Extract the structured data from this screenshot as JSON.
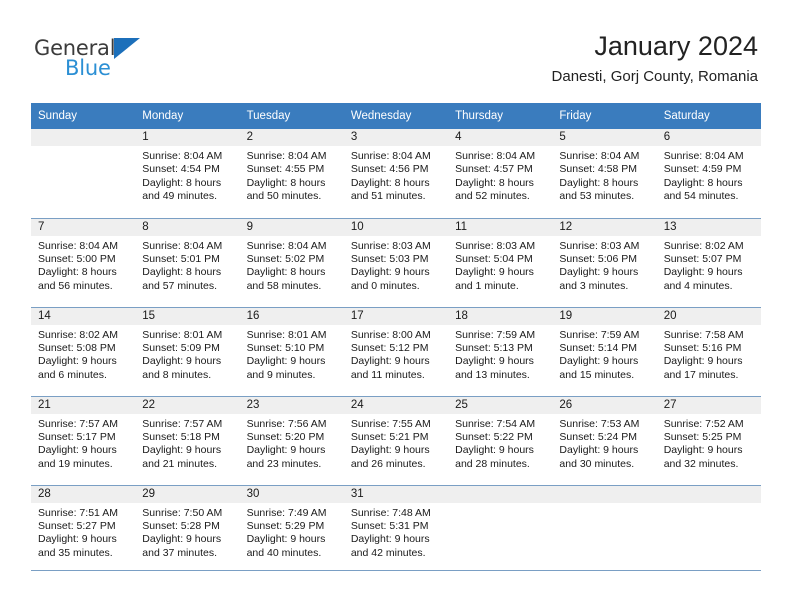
{
  "brand": {
    "name_part1": "General",
    "name_part2": "Blue",
    "triangle_icon": "triangle-icon",
    "color_primary": "#1c6fba",
    "color_secondary": "#2b8fd4"
  },
  "header": {
    "title": "January 2024",
    "subtitle": "Danesti, Gorj County, Romania"
  },
  "calendar": {
    "header_bg": "#3a7cbe",
    "daynum_bg": "#efefef",
    "weekdays": [
      "Sunday",
      "Monday",
      "Tuesday",
      "Wednesday",
      "Thursday",
      "Friday",
      "Saturday"
    ],
    "weeks": [
      [
        {
          "day": "",
          "sunrise": "",
          "sunset": "",
          "daylight": "",
          "empty": true
        },
        {
          "day": "1",
          "sunrise": "Sunrise: 8:04 AM",
          "sunset": "Sunset: 4:54 PM",
          "daylight": "Daylight: 8 hours and 49 minutes."
        },
        {
          "day": "2",
          "sunrise": "Sunrise: 8:04 AM",
          "sunset": "Sunset: 4:55 PM",
          "daylight": "Daylight: 8 hours and 50 minutes."
        },
        {
          "day": "3",
          "sunrise": "Sunrise: 8:04 AM",
          "sunset": "Sunset: 4:56 PM",
          "daylight": "Daylight: 8 hours and 51 minutes."
        },
        {
          "day": "4",
          "sunrise": "Sunrise: 8:04 AM",
          "sunset": "Sunset: 4:57 PM",
          "daylight": "Daylight: 8 hours and 52 minutes."
        },
        {
          "day": "5",
          "sunrise": "Sunrise: 8:04 AM",
          "sunset": "Sunset: 4:58 PM",
          "daylight": "Daylight: 8 hours and 53 minutes."
        },
        {
          "day": "6",
          "sunrise": "Sunrise: 8:04 AM",
          "sunset": "Sunset: 4:59 PM",
          "daylight": "Daylight: 8 hours and 54 minutes."
        }
      ],
      [
        {
          "day": "7",
          "sunrise": "Sunrise: 8:04 AM",
          "sunset": "Sunset: 5:00 PM",
          "daylight": "Daylight: 8 hours and 56 minutes."
        },
        {
          "day": "8",
          "sunrise": "Sunrise: 8:04 AM",
          "sunset": "Sunset: 5:01 PM",
          "daylight": "Daylight: 8 hours and 57 minutes."
        },
        {
          "day": "9",
          "sunrise": "Sunrise: 8:04 AM",
          "sunset": "Sunset: 5:02 PM",
          "daylight": "Daylight: 8 hours and 58 minutes."
        },
        {
          "day": "10",
          "sunrise": "Sunrise: 8:03 AM",
          "sunset": "Sunset: 5:03 PM",
          "daylight": "Daylight: 9 hours and 0 minutes."
        },
        {
          "day": "11",
          "sunrise": "Sunrise: 8:03 AM",
          "sunset": "Sunset: 5:04 PM",
          "daylight": "Daylight: 9 hours and 1 minute."
        },
        {
          "day": "12",
          "sunrise": "Sunrise: 8:03 AM",
          "sunset": "Sunset: 5:06 PM",
          "daylight": "Daylight: 9 hours and 3 minutes."
        },
        {
          "day": "13",
          "sunrise": "Sunrise: 8:02 AM",
          "sunset": "Sunset: 5:07 PM",
          "daylight": "Daylight: 9 hours and 4 minutes."
        }
      ],
      [
        {
          "day": "14",
          "sunrise": "Sunrise: 8:02 AM",
          "sunset": "Sunset: 5:08 PM",
          "daylight": "Daylight: 9 hours and 6 minutes."
        },
        {
          "day": "15",
          "sunrise": "Sunrise: 8:01 AM",
          "sunset": "Sunset: 5:09 PM",
          "daylight": "Daylight: 9 hours and 8 minutes."
        },
        {
          "day": "16",
          "sunrise": "Sunrise: 8:01 AM",
          "sunset": "Sunset: 5:10 PM",
          "daylight": "Daylight: 9 hours and 9 minutes."
        },
        {
          "day": "17",
          "sunrise": "Sunrise: 8:00 AM",
          "sunset": "Sunset: 5:12 PM",
          "daylight": "Daylight: 9 hours and 11 minutes."
        },
        {
          "day": "18",
          "sunrise": "Sunrise: 7:59 AM",
          "sunset": "Sunset: 5:13 PM",
          "daylight": "Daylight: 9 hours and 13 minutes."
        },
        {
          "day": "19",
          "sunrise": "Sunrise: 7:59 AM",
          "sunset": "Sunset: 5:14 PM",
          "daylight": "Daylight: 9 hours and 15 minutes."
        },
        {
          "day": "20",
          "sunrise": "Sunrise: 7:58 AM",
          "sunset": "Sunset: 5:16 PM",
          "daylight": "Daylight: 9 hours and 17 minutes."
        }
      ],
      [
        {
          "day": "21",
          "sunrise": "Sunrise: 7:57 AM",
          "sunset": "Sunset: 5:17 PM",
          "daylight": "Daylight: 9 hours and 19 minutes."
        },
        {
          "day": "22",
          "sunrise": "Sunrise: 7:57 AM",
          "sunset": "Sunset: 5:18 PM",
          "daylight": "Daylight: 9 hours and 21 minutes."
        },
        {
          "day": "23",
          "sunrise": "Sunrise: 7:56 AM",
          "sunset": "Sunset: 5:20 PM",
          "daylight": "Daylight: 9 hours and 23 minutes."
        },
        {
          "day": "24",
          "sunrise": "Sunrise: 7:55 AM",
          "sunset": "Sunset: 5:21 PM",
          "daylight": "Daylight: 9 hours and 26 minutes."
        },
        {
          "day": "25",
          "sunrise": "Sunrise: 7:54 AM",
          "sunset": "Sunset: 5:22 PM",
          "daylight": "Daylight: 9 hours and 28 minutes."
        },
        {
          "day": "26",
          "sunrise": "Sunrise: 7:53 AM",
          "sunset": "Sunset: 5:24 PM",
          "daylight": "Daylight: 9 hours and 30 minutes."
        },
        {
          "day": "27",
          "sunrise": "Sunrise: 7:52 AM",
          "sunset": "Sunset: 5:25 PM",
          "daylight": "Daylight: 9 hours and 32 minutes."
        }
      ],
      [
        {
          "day": "28",
          "sunrise": "Sunrise: 7:51 AM",
          "sunset": "Sunset: 5:27 PM",
          "daylight": "Daylight: 9 hours and 35 minutes."
        },
        {
          "day": "29",
          "sunrise": "Sunrise: 7:50 AM",
          "sunset": "Sunset: 5:28 PM",
          "daylight": "Daylight: 9 hours and 37 minutes."
        },
        {
          "day": "30",
          "sunrise": "Sunrise: 7:49 AM",
          "sunset": "Sunset: 5:29 PM",
          "daylight": "Daylight: 9 hours and 40 minutes."
        },
        {
          "day": "31",
          "sunrise": "Sunrise: 7:48 AM",
          "sunset": "Sunset: 5:31 PM",
          "daylight": "Daylight: 9 hours and 42 minutes."
        },
        {
          "day": "",
          "sunrise": "",
          "sunset": "",
          "daylight": "",
          "empty": true
        },
        {
          "day": "",
          "sunrise": "",
          "sunset": "",
          "daylight": "",
          "empty": true
        },
        {
          "day": "",
          "sunrise": "",
          "sunset": "",
          "daylight": "",
          "empty": true
        }
      ]
    ]
  }
}
